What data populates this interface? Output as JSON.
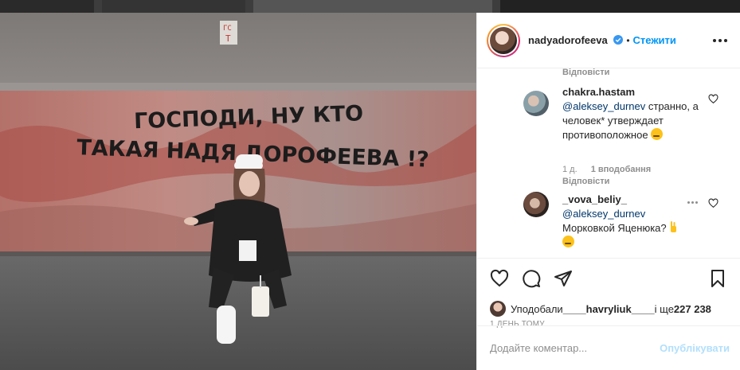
{
  "header": {
    "username": "nadyadorofeeva",
    "separator": "•",
    "follow_label": "Стежити"
  },
  "photo": {
    "graffiti_line1": "ГОСПОДИ, НУ КТО",
    "graffiti_line2": "ТАКАЯ НАДЯ ДОРОФЕЕВА !?",
    "tag1": "ГС",
    "tag2": "Т"
  },
  "comments": {
    "top_reply_label": "Відповісти",
    "items": [
      {
        "username": "chakra.hastam",
        "mention": "@aleksey_durnev",
        "text_after_mention": " странно, а человек* утверждает противоположное",
        "emoji_icon": "thinking-face-emoji",
        "age": "1 д.",
        "likes": "1 вподобання",
        "reply_label": "Відповісти"
      },
      {
        "username": "_vova_beliy_",
        "mention": "@aleksey_durnev",
        "text_after_mention": "Морковкой Яценюка?",
        "emoji_icon": "victory-hand-emoji",
        "emoji_icon_2": "winking-face-emoji"
      }
    ]
  },
  "likes": {
    "prefix": "Уподобали ",
    "user": "____havryliuk____",
    "middle": " і ще ",
    "count": "227 238"
  },
  "timestamp": "1 ДЕНЬ ТОМУ",
  "add_comment": {
    "placeholder": "Додайте коментар...",
    "publish_label": "Опублікувати"
  },
  "colors": {
    "accent": "#0095f6",
    "publish_disabled": "#b2dffc",
    "mention": "#00376b",
    "meta": "#8e8e8e"
  }
}
